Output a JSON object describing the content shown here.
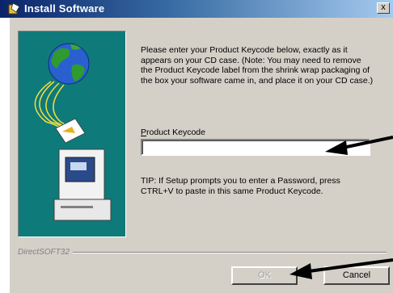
{
  "window": {
    "title": "Install Software",
    "close_glyph": "x"
  },
  "content": {
    "instructions": "Please enter your Product Keycode below, exactly as it appears on your CD case. (Note: You may need to remove the Product Keycode label from the shrink wrap packaging of the box your software came in, and place it on your CD case.)",
    "keycode_label_underlined": "P",
    "keycode_label_rest": "roduct Keycode",
    "keycode_value": "",
    "tip": "TIP: If Setup prompts you to enter a Password, press CTRL+V to paste in this same Product Keycode."
  },
  "footer": {
    "brand": "DirectSOFT32",
    "ok_label": "OK",
    "cancel_label": "Cancel"
  },
  "colors": {
    "panel_teal": "#0f7a7a",
    "dialog_gray": "#d4d0c8",
    "titlebar": "#0a246a"
  }
}
